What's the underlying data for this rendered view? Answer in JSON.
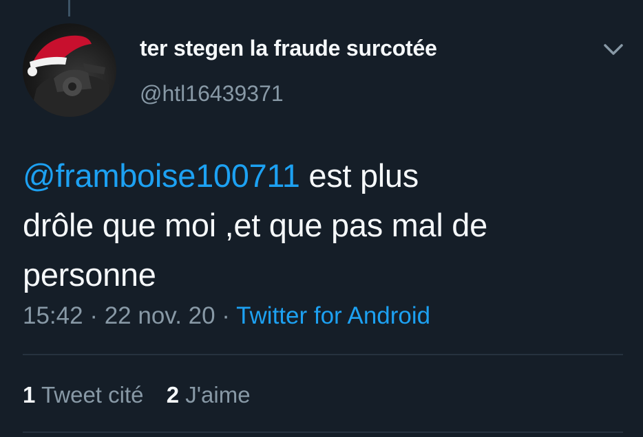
{
  "tweet": {
    "display_name": "ter stegen la fraude surcotée",
    "handle": "@htl16439371",
    "mention": "@framboise100711",
    "text_line1_rest": " est plus",
    "text_line2": "drôle que moi ,et que pas mal de",
    "text_line3": "personne",
    "time": "15:42",
    "separator": " · ",
    "date": "22 nov. 20",
    "source": "Twitter for Android",
    "stats": {
      "quotes_count": "1",
      "quotes_label": "Tweet cité",
      "likes_count": "2",
      "likes_label": "J'aime"
    }
  },
  "colors": {
    "background": "#151e28",
    "primary_text": "#f5f8fa",
    "secondary_text": "#8899a6",
    "accent": "#1da1f2",
    "divider": "#26323f"
  },
  "icons": {
    "avatar": "santa-hat-motorcycle-avatar",
    "menu": "chevron-down-icon"
  }
}
